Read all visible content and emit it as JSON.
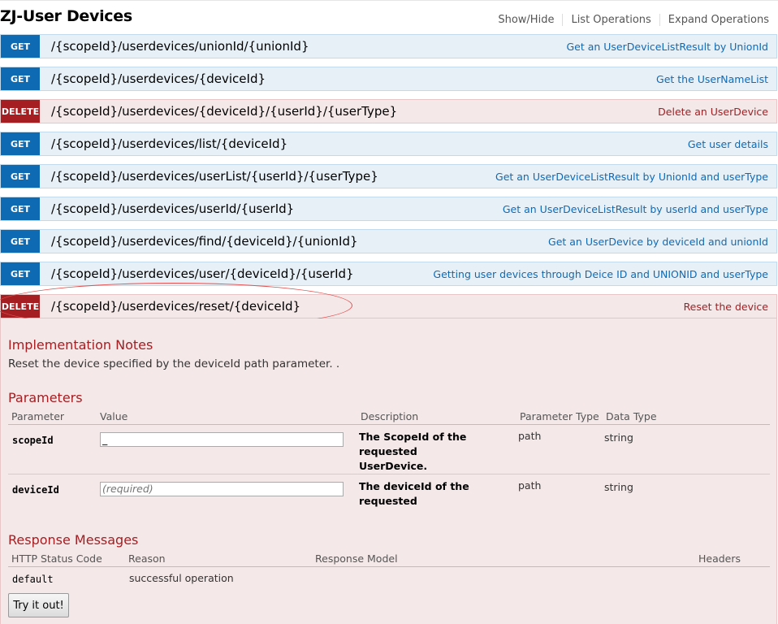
{
  "resource": {
    "title": "ZJ-User Devices",
    "links": [
      "Show/Hide",
      "List Operations",
      "Expand Operations"
    ]
  },
  "operations": [
    {
      "method": "GET",
      "path": "/{scopeId}/userdevices/unionId/{unionId}",
      "summary": "Get an UserDeviceListResult by UnionId"
    },
    {
      "method": "GET",
      "path": "/{scopeId}/userdevices/{deviceId}",
      "summary": "Get the UserNameList"
    },
    {
      "method": "DELETE",
      "path": "/{scopeId}/userdevices/{deviceId}/{userId}/{userType}",
      "summary": "Delete an UserDevice"
    },
    {
      "method": "GET",
      "path": "/{scopeId}/userdevices/list/{deviceId}",
      "summary": "Get user details"
    },
    {
      "method": "GET",
      "path": "/{scopeId}/userdevices/userList/{userId}/{userType}",
      "summary": "Get an UserDeviceListResult by UnionId and userType"
    },
    {
      "method": "GET",
      "path": "/{scopeId}/userdevices/userId/{userId}",
      "summary": "Get an UserDeviceListResult by userId and userType"
    },
    {
      "method": "GET",
      "path": "/{scopeId}/userdevices/find/{deviceId}/{unionId}",
      "summary": "Get an UserDevice by deviceId and unionId"
    },
    {
      "method": "GET",
      "path": "/{scopeId}/userdevices/user/{deviceId}/{userId}",
      "summary": "Getting user devices through Deice ID and UNIONID and userType"
    },
    {
      "method": "DELETE",
      "path": "/{scopeId}/userdevices/reset/{deviceId}",
      "summary": "Reset the device"
    }
  ],
  "expanded": {
    "notes_heading": "Implementation Notes",
    "notes_text": "Reset the device specified by the deviceId path parameter. .",
    "params_heading": "Parameters",
    "param_columns": [
      "Parameter",
      "Value",
      "Description",
      "Parameter Type",
      "Data Type"
    ],
    "params": [
      {
        "name": "scopeId",
        "value": "_",
        "placeholder": "",
        "description_line1": "The ScopeId of the requested",
        "description_line2": "UserDevice.",
        "param_type": "path",
        "data_type": "string"
      },
      {
        "name": "deviceId",
        "value": "",
        "placeholder": "(required)",
        "description_line1": "The deviceId of the",
        "description_line2": "requested",
        "param_type": "path",
        "data_type": "string"
      }
    ],
    "responses_heading": "Response Messages",
    "response_columns": [
      "HTTP Status Code",
      "Reason",
      "Response Model",
      "Headers"
    ],
    "responses": [
      {
        "code": "default",
        "reason": "successful operation",
        "model": "",
        "headers": ""
      }
    ],
    "try_button": "Try it out!"
  }
}
